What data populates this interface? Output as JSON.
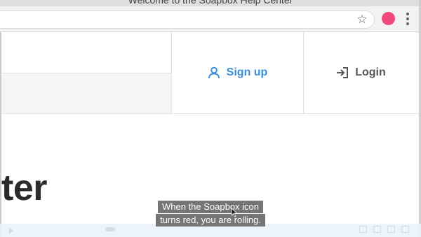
{
  "browser": {
    "window_title": "Welcome to the Soapbox Help Center",
    "accent_profile_color": "#f2487a",
    "icons": {
      "bookmark": "star-icon",
      "menu": "kebab-menu-icon"
    }
  },
  "header": {
    "signup_label": "Sign up",
    "login_label": "Login",
    "signup_color": "#3b8fd9"
  },
  "hero": {
    "title_fragment": "ter"
  },
  "captions": {
    "line1": "When the Soapbox icon",
    "line2": "turns red, you are rolling."
  }
}
